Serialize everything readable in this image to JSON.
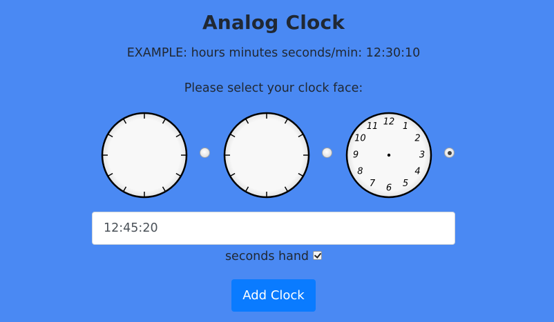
{
  "page": {
    "title": "Analog Clock",
    "example": "EXAMPLE: hours minutes seconds/min: 12:30:10",
    "prompt": "Please select your clock face:"
  },
  "clock_faces": [
    {
      "style": "ticks-only",
      "selected": false
    },
    {
      "style": "ticks-only",
      "selected": false
    },
    {
      "style": "numbered",
      "selected": true,
      "numbers": [
        "12",
        "1",
        "2",
        "3",
        "4",
        "5",
        "6",
        "7",
        "8",
        "9",
        "10",
        "11"
      ]
    }
  ],
  "time_input": {
    "value": "12:45:20"
  },
  "seconds_hand": {
    "label": "seconds hand",
    "checked": true
  },
  "add_button": {
    "label": "Add Clock",
    "color": "#0a7bff"
  },
  "colors": {
    "background": "#4a89f3",
    "clock_face": "#f8f8f8",
    "clock_outline": "#000000"
  }
}
